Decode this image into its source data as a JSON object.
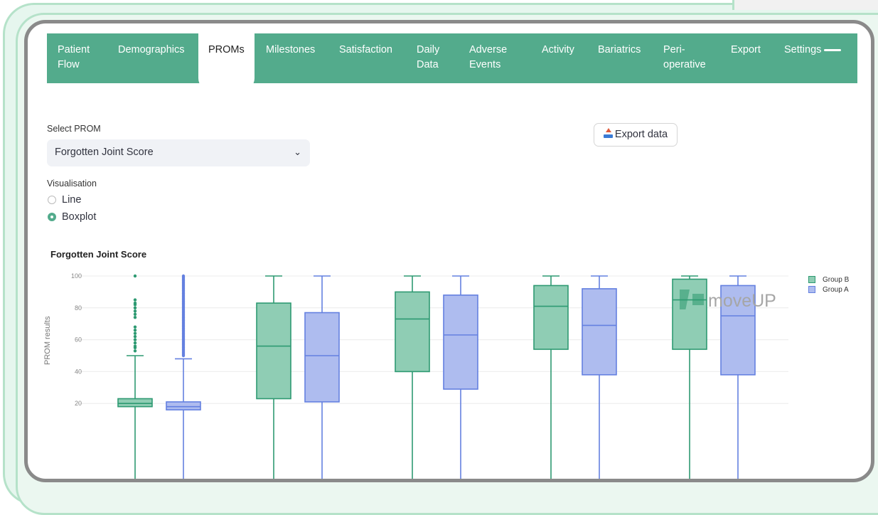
{
  "nav": {
    "tabs": [
      {
        "label": "Patient\nFlow",
        "active": false
      },
      {
        "label": "Demographics",
        "active": false
      },
      {
        "label": "PROMs",
        "active": true
      },
      {
        "label": "Milestones",
        "active": false
      },
      {
        "label": "Satisfaction",
        "active": false
      },
      {
        "label": "Daily\nData",
        "active": false
      },
      {
        "label": "Adverse\nEvents",
        "active": false
      },
      {
        "label": "Activity",
        "active": false
      },
      {
        "label": "Bariatrics",
        "active": false
      },
      {
        "label": "Peri-\noperative",
        "active": false
      },
      {
        "label": "Export",
        "active": false
      },
      {
        "label": "Settings",
        "active": false
      }
    ],
    "settings_icon": "hamburger-icon"
  },
  "controls": {
    "select_label": "Select PROM",
    "select_value": "Forgotten Joint Score",
    "visualisation_label": "Visualisation",
    "options": [
      {
        "label": "Line",
        "selected": false
      },
      {
        "label": "Boxplot",
        "selected": true
      }
    ],
    "export_label": "Export data",
    "export_icon": "inbox-tray-icon"
  },
  "watermark": "moveUP",
  "colors": {
    "accent": "#53ab8c",
    "group_b_fill": "#8fcdb4",
    "group_b_line": "#2e9a72",
    "group_a_fill": "#aebcef",
    "group_a_line": "#6480e0"
  },
  "chart_data": {
    "type": "box",
    "title": "Forgotten Joint Score",
    "ylabel": "PROM results",
    "yticks": [
      20,
      40,
      60,
      80,
      100
    ],
    "ylim": [
      20,
      100
    ],
    "grid": true,
    "legend_position": "top-right",
    "legend": [
      "Group B",
      "Group A"
    ],
    "series": [
      {
        "name": "Group B",
        "boxes": [
          {
            "q1": 18,
            "median": 20,
            "q3": 23,
            "whisker_high": 50,
            "outliers": [
              53,
              55,
              56,
              58,
              60,
              62,
              64,
              66,
              68,
              74,
              76,
              78,
              80,
              82,
              83,
              85,
              100
            ]
          },
          {
            "q1": 23,
            "median": 56,
            "q3": 83,
            "whisker_high": 100
          },
          {
            "q1": 40,
            "median": 73,
            "q3": 90,
            "whisker_high": 100
          },
          {
            "q1": 54,
            "median": 81,
            "q3": 94,
            "whisker_high": 100
          },
          {
            "q1": 54,
            "median": 85,
            "q3": 98,
            "whisker_high": 100
          }
        ]
      },
      {
        "name": "Group A",
        "boxes": [
          {
            "q1": 16,
            "median": 18,
            "q3": 21,
            "whisker_high": 48,
            "outliers": [
              50,
              51,
              52,
              53,
              54,
              55,
              56,
              57,
              58,
              59,
              60,
              61,
              62,
              63,
              64,
              65,
              66,
              67,
              68,
              69,
              70,
              71,
              72,
              73,
              74,
              75,
              76,
              77,
              78,
              79,
              80,
              81,
              82,
              83,
              84,
              85,
              86,
              87,
              88,
              89,
              90,
              91,
              92,
              93,
              94,
              95,
              96,
              97,
              98,
              99,
              100
            ]
          },
          {
            "q1": 21,
            "median": 50,
            "q3": 77,
            "whisker_high": 100
          },
          {
            "q1": 29,
            "median": 63,
            "q3": 88,
            "whisker_high": 100
          },
          {
            "q1": 38,
            "median": 69,
            "q3": 92,
            "whisker_high": 100
          },
          {
            "q1": 38,
            "median": 75,
            "q3": 94,
            "whisker_high": 100
          }
        ]
      }
    ]
  }
}
